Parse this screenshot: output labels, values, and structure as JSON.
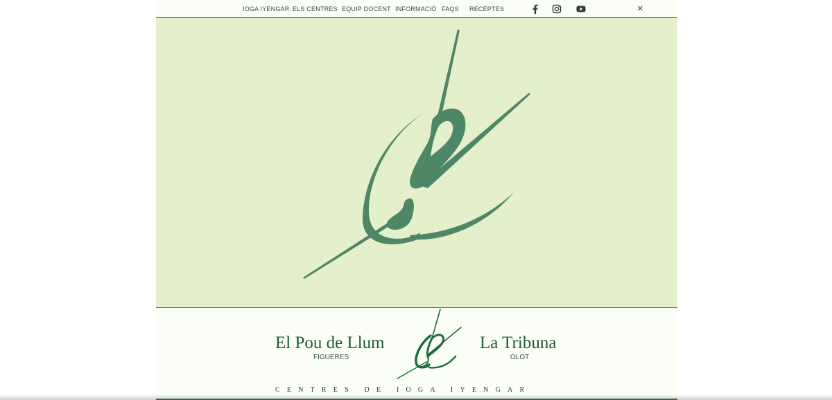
{
  "nav": {
    "items": [
      {
        "label": "IOGA IYENGAR"
      },
      {
        "label": "ELS CENTRES"
      },
      {
        "label": "EQUIP DOCENT"
      },
      {
        "label": "INFORMACIÓ"
      },
      {
        "label": "FAQS"
      },
      {
        "label": "RECEPTES"
      }
    ],
    "close_label": "×"
  },
  "social": {
    "icons": [
      "facebook-icon",
      "instagram-icon",
      "youtube-icon"
    ]
  },
  "brand": {
    "left_center_name": "El Pou de Llum",
    "left_center_city": "FIGUERES",
    "right_center_name": "La Tribuna",
    "right_center_city": "OLOT",
    "tagline": "CENTRES DE IOGA IYENGAR"
  },
  "colors": {
    "hero_background": "#e4f0cb",
    "logo_green": "#4e8766",
    "brand_green": "#1f6b3a"
  }
}
